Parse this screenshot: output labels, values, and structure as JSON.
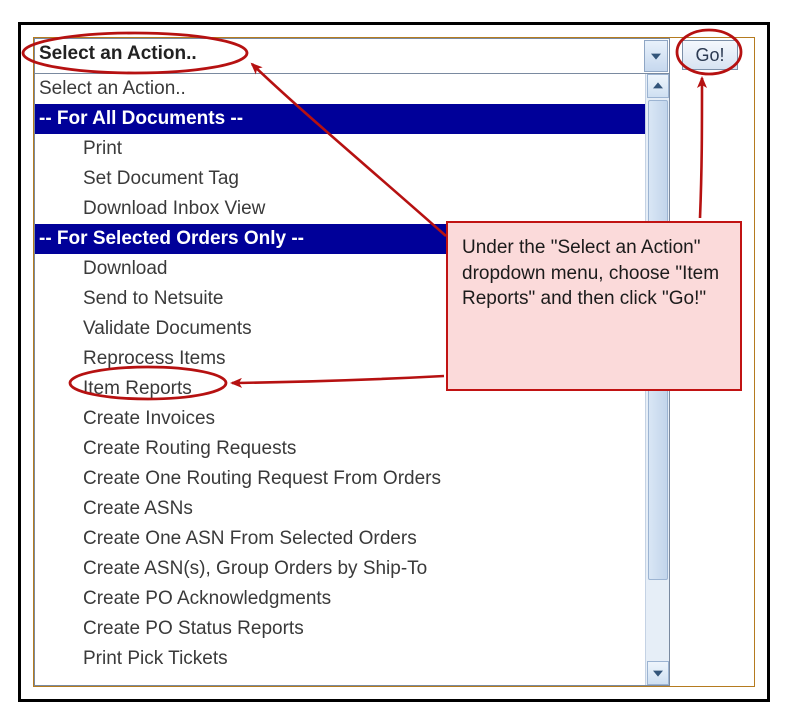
{
  "action": {
    "selected_label": "Select an Action..",
    "go_label": "Go!"
  },
  "dropdown": {
    "top_option": "Select an Action..",
    "section_all_label": "-- For All Documents --",
    "section_all_items": {
      "i0": "Print",
      "i1": "Set Document Tag",
      "i2": "Download Inbox View"
    },
    "section_sel_label": "-- For Selected Orders Only --",
    "section_sel_items": {
      "i0": "Download",
      "i1": "Send to Netsuite",
      "i2": "Validate Documents",
      "i3": "Reprocess Items",
      "i4": "Item Reports",
      "i5": "Create Invoices",
      "i6": "Create Routing Requests",
      "i7": "Create One Routing Request From Orders",
      "i8": "Create ASNs",
      "i9": "Create One ASN From Selected Orders",
      "i10": "Create ASN(s), Group Orders by Ship-To",
      "i11": "Create PO Acknowledgments",
      "i12": "Create PO Status Reports",
      "i13": "Print Pick Tickets"
    }
  },
  "annotation": {
    "text": "Under the \"Select an Action\" dropdown menu, choose \"Item Reports\" and then click \"Go!\""
  }
}
